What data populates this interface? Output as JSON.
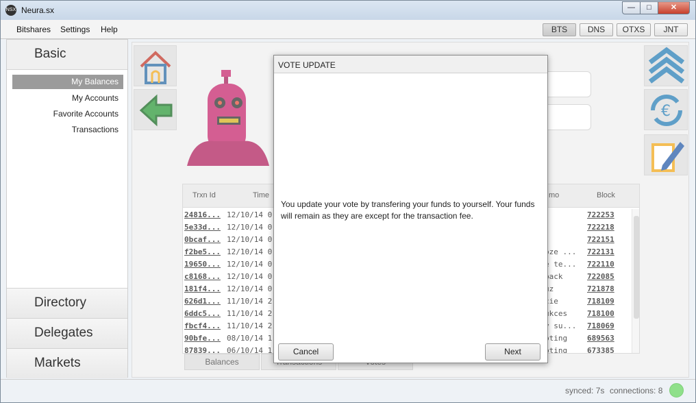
{
  "window": {
    "title": "Neura.sx",
    "icon_text": "NSX"
  },
  "menubar": {
    "items": [
      "Bitshares",
      "Settings",
      "Help"
    ]
  },
  "network_tabs": [
    {
      "label": "BTS",
      "active": true
    },
    {
      "label": "DNS",
      "active": false
    },
    {
      "label": "OTXS",
      "active": false
    },
    {
      "label": "JNT",
      "active": false
    }
  ],
  "sidebar": {
    "header": "Basic",
    "links": [
      "My Balances",
      "My Accounts",
      "Favorite Accounts",
      "Transactions"
    ],
    "selected_link": "My Balances",
    "sections": [
      "Directory",
      "Delegates",
      "Markets"
    ]
  },
  "icons": {
    "left_tiles": [
      "home-icon",
      "back-arrow-icon"
    ],
    "right_tiles": [
      "chevrons-up-icon",
      "currency-exchange-icon",
      "edit-pencil-icon"
    ],
    "mascot": "robot-mascot"
  },
  "transactions": {
    "columns": [
      "Trxn Id",
      "Time",
      "mo",
      "Block"
    ],
    "rows": [
      {
        "id": "24816...",
        "time": "12/10/14 0",
        "memo": "",
        "block": "722253"
      },
      {
        "id": "5e33d...",
        "time": "12/10/14 0",
        "memo": "",
        "block": "722218"
      },
      {
        "id": "0bcaf...",
        "time": "12/10/14 0",
        "memo": "",
        "block": "722151"
      },
      {
        "id": "f2be5...",
        "time": "12/10/14 0",
        "memo": "oze ...",
        "block": "722131"
      },
      {
        "id": "19650...",
        "time": "12/10/14 0",
        "memo": "e te...",
        "block": "722110"
      },
      {
        "id": "c8168...",
        "time": "12/10/14 0",
        "memo": "back",
        "block": "722085"
      },
      {
        "id": "181f4...",
        "time": "12/10/14 0",
        "memo": "uz",
        "block": "721878"
      },
      {
        "id": "626d1...",
        "time": "11/10/14 2",
        "memo": "cie",
        "block": "718109"
      },
      {
        "id": "6ddc5...",
        "time": "11/10/14 2",
        "memo": "ukces",
        "block": "718100"
      },
      {
        "id": "fbcf4...",
        "time": "11/10/14 2",
        "memo": "y su...",
        "block": "718069"
      },
      {
        "id": "90bfe...",
        "time": "08/10/14 1",
        "memo": "pting",
        "block": "689563"
      },
      {
        "id": "87839...",
        "time": "06/10/14 1",
        "memo": "pting",
        "block": "673385"
      }
    ]
  },
  "bottom_tabs": [
    "Balances",
    "Transactions",
    "Votes"
  ],
  "dialog": {
    "title": "VOTE UPDATE",
    "message": "You update your vote by transfering your funds to yourself. Your funds will remain as they are except for the transaction fee.",
    "cancel_label": "Cancel",
    "next_label": "Next"
  },
  "status": {
    "synced": "synced: 7s",
    "connections": "connections: 8",
    "indicator_color": "#8fe08a"
  }
}
